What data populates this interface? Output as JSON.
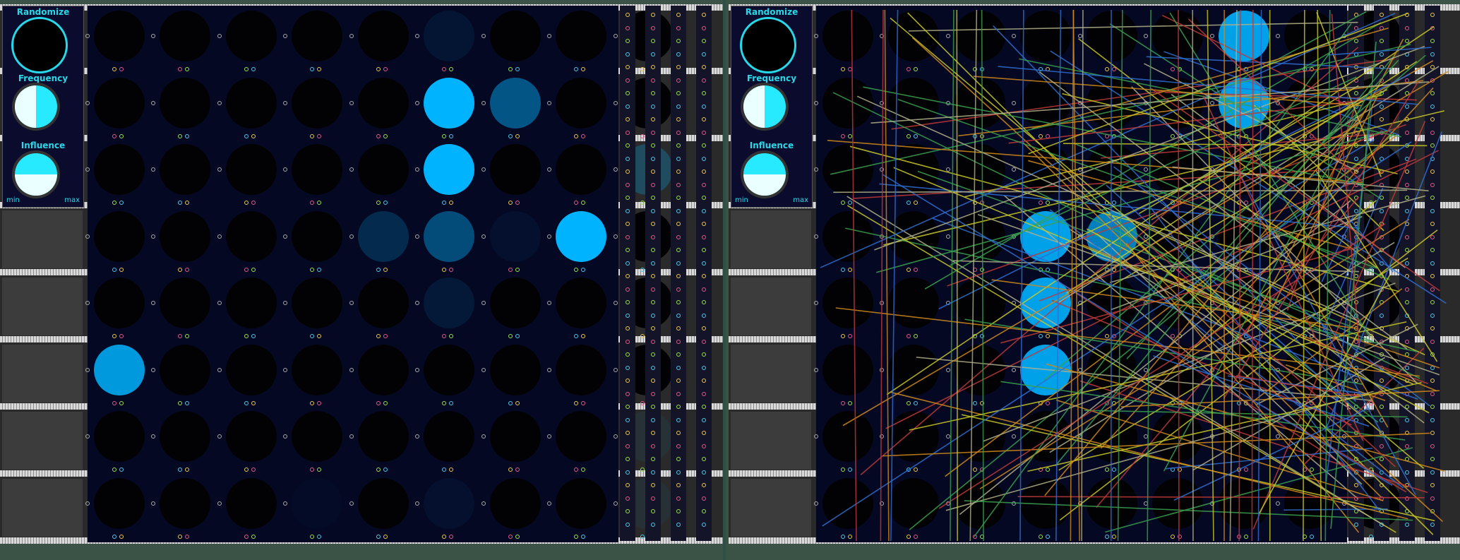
{
  "panel_left": {
    "labels": {
      "randomize": "Randomize",
      "frequency": "Frequency",
      "influence": "Influence",
      "min": "min",
      "max": "max"
    },
    "frequency_level": 0.75,
    "influence_level": 0.6,
    "cells": [
      [
        0,
        0,
        0,
        0,
        0,
        0.08,
        0,
        0,
        0
      ],
      [
        0,
        0,
        0,
        0,
        0,
        1.0,
        0.45,
        0,
        0
      ],
      [
        0,
        0,
        0,
        0,
        0,
        1.0,
        0,
        0,
        0.25
      ],
      [
        0,
        0,
        0,
        0,
        0.2,
        0.4,
        0.05,
        1.0,
        0
      ],
      [
        0,
        0,
        0,
        0,
        0,
        0.1,
        0,
        0,
        0
      ],
      [
        0.85,
        0,
        0,
        0,
        0,
        0,
        0,
        0,
        0
      ],
      [
        0,
        0,
        0,
        0,
        0,
        0,
        0,
        0,
        0.06
      ],
      [
        0,
        0,
        0,
        0.02,
        0,
        0.05,
        0,
        0,
        0.05
      ]
    ]
  },
  "panel_right": {
    "labels": {
      "randomize": "Randomize",
      "frequency": "Frequency",
      "influence": "Influence",
      "min": "min",
      "max": "max"
    },
    "frequency_level": 0.75,
    "influence_level": 0.6,
    "cells": [
      [
        0,
        0,
        0,
        0,
        0,
        0,
        0.9,
        0,
        0
      ],
      [
        0,
        0,
        0,
        0,
        0,
        0,
        0.9,
        0,
        0
      ],
      [
        0,
        0,
        0,
        0,
        0,
        0,
        0,
        0,
        0
      ],
      [
        0,
        0,
        0,
        0.9,
        0.7,
        0,
        0,
        0,
        0
      ],
      [
        0,
        0,
        0,
        0.9,
        0,
        0,
        0,
        0,
        0
      ],
      [
        0,
        0,
        0,
        0.9,
        0,
        0,
        0,
        0,
        0
      ],
      [
        0,
        0,
        0,
        0,
        0,
        0,
        0,
        0,
        0
      ],
      [
        0,
        0,
        0,
        0,
        0,
        0,
        0,
        0,
        0
      ]
    ]
  },
  "colors": {
    "accent": "#27d9e8",
    "cell_on": "#00b3ff",
    "cable_palette": [
      "#c9c926",
      "#c03a3a",
      "#3aa04f",
      "#2f6fd0",
      "#b0b08a",
      "#d08a1a"
    ]
  }
}
